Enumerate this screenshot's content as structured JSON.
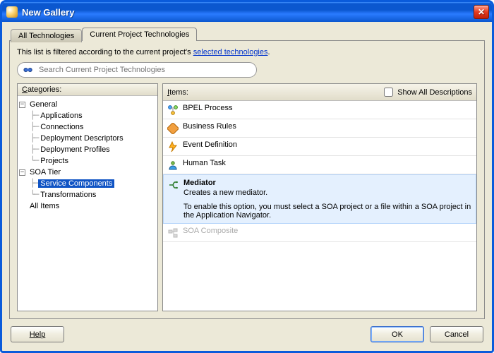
{
  "window": {
    "title": "New Gallery"
  },
  "tabs": {
    "all": "All Technologies",
    "current": "Current Project Technologies"
  },
  "filter": {
    "prefix": "This list is filtered according to the current project's ",
    "link": "selected technologies",
    "suffix": "."
  },
  "search": {
    "placeholder": "Search Current Project Technologies"
  },
  "leftPane": {
    "header": "Categories:",
    "headerUnderline": "C"
  },
  "tree": {
    "general": "General",
    "general_children": {
      "applications": "Applications",
      "connections": "Connections",
      "deployment_descriptors": "Deployment Descriptors",
      "deployment_profiles": "Deployment Profiles",
      "projects": "Projects"
    },
    "soa": "SOA Tier",
    "soa_children": {
      "service_components": "Service Components",
      "transformations": "Transformations"
    },
    "all_items": "All Items"
  },
  "rightPane": {
    "header": "Items:",
    "headerUnderline": "I",
    "showAll": "Show All Descriptions"
  },
  "items": {
    "bpel": "BPEL Process",
    "rules": "Business Rules",
    "event": "Event Definition",
    "human": "Human Task",
    "mediator": {
      "title": "Mediator",
      "desc": "Creates a new mediator.",
      "more": "To enable this option, you must select a SOA project or a file within a SOA project in the Application Navigator."
    },
    "composite": "SOA Composite"
  },
  "footer": {
    "help": "Help",
    "ok": "OK",
    "cancel": "Cancel"
  }
}
